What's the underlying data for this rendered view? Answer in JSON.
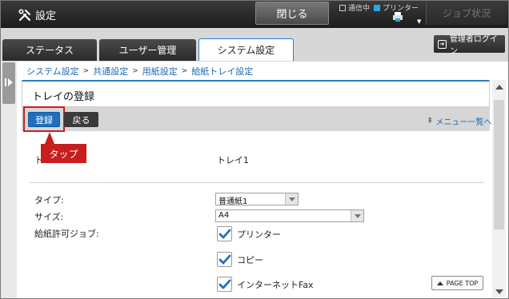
{
  "app": {
    "title": "設定",
    "icon": "tools-icon"
  },
  "topbar": {
    "close_label": "閉じる",
    "status": [
      {
        "label": "通信中",
        "active": false
      },
      {
        "label": "プリンター",
        "active": true
      }
    ],
    "job_status_label": "ジョブ状況"
  },
  "tabs": [
    {
      "label": "ステータス",
      "active": false
    },
    {
      "label": "ユーザー管理",
      "active": false
    },
    {
      "label": "システム設定",
      "active": true
    }
  ],
  "admin_login_label": "管理者ログイン",
  "breadcrumb": [
    "システム設定",
    "共通設定",
    "用紙設定",
    "給紙トレイ設定"
  ],
  "breadcrumb_sep": ">",
  "panel": {
    "title": "トレイの登録",
    "register_label": "登録",
    "back_label": "戻る",
    "menu_link": "メニュー一覧へ"
  },
  "annotation": {
    "tap_label": "タップ"
  },
  "form": {
    "tray_label_hint": "ト",
    "tray_value": "トレイ1",
    "type_label": "タイプ:",
    "type_value": "普通紙1",
    "size_label": "サイズ:",
    "size_value": "A4",
    "jobs_label": "給紙許可ジョブ:",
    "jobs": [
      {
        "label": "プリンター",
        "checked": true
      },
      {
        "label": "コピー",
        "checked": true
      },
      {
        "label": "インターネットFax",
        "checked": true
      }
    ]
  },
  "page_top_label": "PAGE TOP",
  "colors": {
    "accent": "#1f6fc0",
    "highlight": "#c81e1e"
  }
}
